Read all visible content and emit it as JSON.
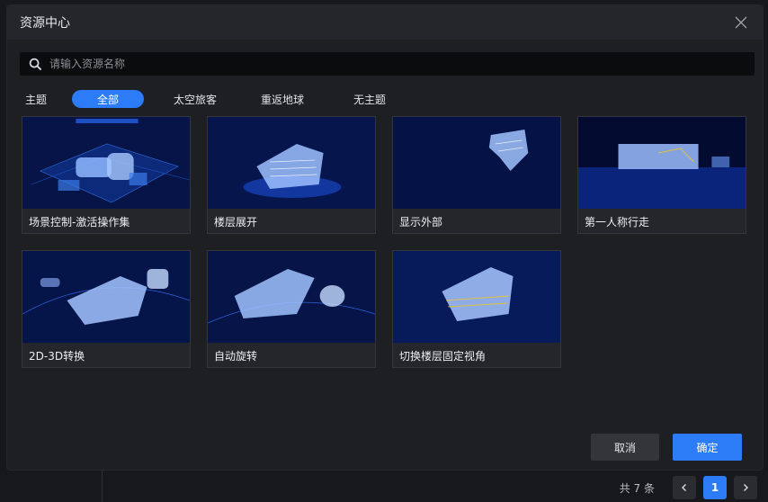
{
  "dialog": {
    "title": "资源中心",
    "search_placeholder": "请输入资源名称",
    "theme_label": "主题",
    "tabs": [
      {
        "label": "全部",
        "active": true
      },
      {
        "label": "太空旅客",
        "active": false
      },
      {
        "label": "重返地球",
        "active": false
      },
      {
        "label": "无主题",
        "active": false
      }
    ],
    "resources": [
      {
        "name": "场景控制-激活操作集",
        "thumb": "city-overview"
      },
      {
        "name": "楼层展开",
        "thumb": "floor-expand"
      },
      {
        "name": "显示外部",
        "thumb": "exterior"
      },
      {
        "name": "第一人称行走",
        "thumb": "first-person"
      },
      {
        "name": "2D-3D转换",
        "thumb": "2d-3d"
      },
      {
        "name": "自动旋转",
        "thumb": "auto-rotate"
      },
      {
        "name": "切换楼层固定视角",
        "thumb": "floor-view"
      }
    ],
    "cancel_label": "取消",
    "ok_label": "确定"
  },
  "pager": {
    "total_text": "共 7 条",
    "current_page": "1"
  },
  "colors": {
    "accent": "#2b7cf6",
    "dialog_bg": "#1e1f23",
    "header_bg": "#25262b"
  }
}
